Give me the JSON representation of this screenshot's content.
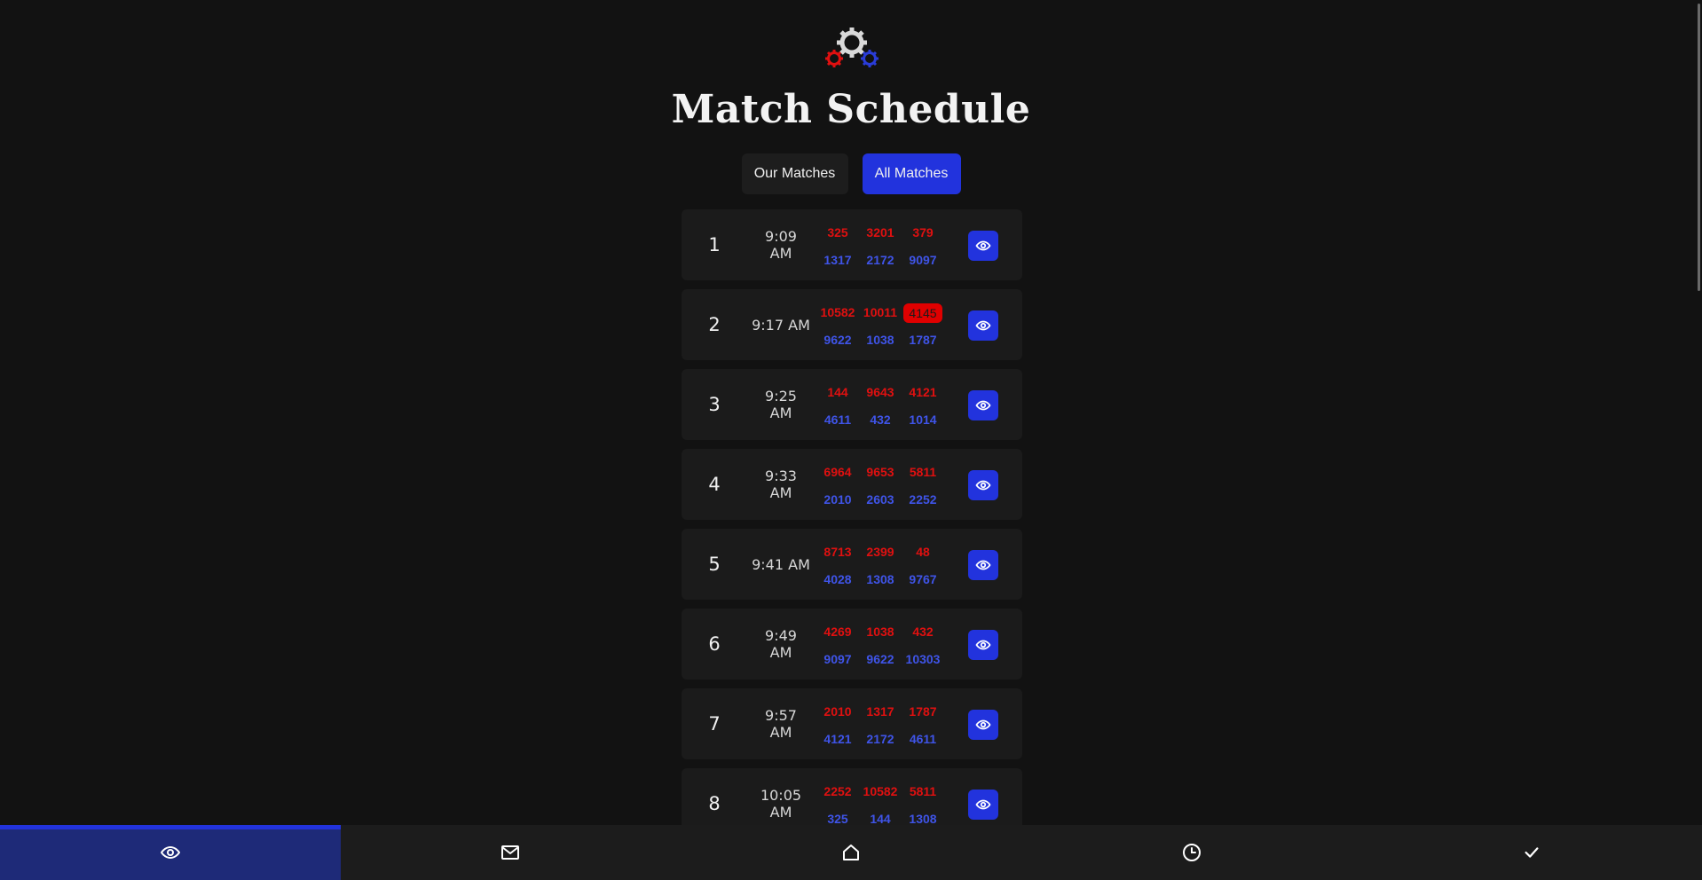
{
  "page": {
    "title": "Match Schedule"
  },
  "toggle": {
    "ours_label": "Our Matches",
    "all_label": "All Matches",
    "selected": "All Matches"
  },
  "colors": {
    "accent": "#2233dd",
    "red_alliance": "#e01010",
    "blue_alliance": "#3f54e8",
    "background": "#121212",
    "row": "#1b1b1b"
  },
  "matches": [
    {
      "number": "1",
      "time": "9:09 AM",
      "red": [
        "325",
        "3201",
        "379"
      ],
      "blue": [
        "1317",
        "2172",
        "9097"
      ]
    },
    {
      "number": "2",
      "time": "9:17 AM",
      "red": [
        "10582",
        "10011",
        "4145"
      ],
      "blue": [
        "9622",
        "1038",
        "1787"
      ],
      "highlighted_team": "4145"
    },
    {
      "number": "3",
      "time": "9:25 AM",
      "red": [
        "144",
        "9643",
        "4121"
      ],
      "blue": [
        "4611",
        "432",
        "1014"
      ]
    },
    {
      "number": "4",
      "time": "9:33 AM",
      "red": [
        "6964",
        "9653",
        "5811"
      ],
      "blue": [
        "2010",
        "2603",
        "2252"
      ]
    },
    {
      "number": "5",
      "time": "9:41 AM",
      "red": [
        "8713",
        "2399",
        "48"
      ],
      "blue": [
        "4028",
        "1308",
        "9767"
      ]
    },
    {
      "number": "6",
      "time": "9:49 AM",
      "red": [
        "4269",
        "1038",
        "432"
      ],
      "blue": [
        "9097",
        "9622",
        "10303"
      ]
    },
    {
      "number": "7",
      "time": "9:57 AM",
      "red": [
        "2010",
        "1317",
        "1787"
      ],
      "blue": [
        "4121",
        "2172",
        "4611"
      ]
    },
    {
      "number": "8",
      "time": "10:05 AM",
      "red": [
        "2252",
        "10582",
        "5811"
      ],
      "blue": [
        "325",
        "144",
        "1308"
      ]
    }
  ],
  "nav": [
    {
      "name": "eye-icon",
      "active": true
    },
    {
      "name": "mail-icon",
      "active": false
    },
    {
      "name": "home-icon",
      "active": false
    },
    {
      "name": "clock-icon",
      "active": false
    },
    {
      "name": "check-icon",
      "active": false
    }
  ]
}
